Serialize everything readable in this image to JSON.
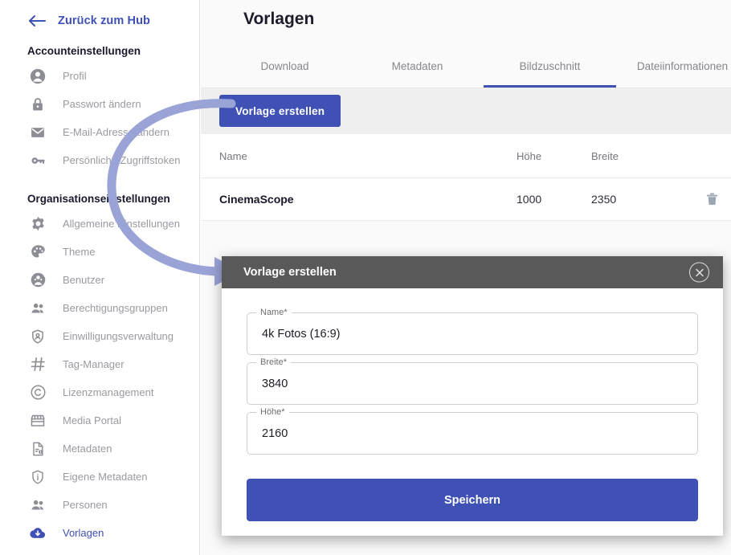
{
  "sidebar": {
    "back_link": {
      "label": "Zurück zum Hub",
      "icon": "arrow-left-icon"
    },
    "account_section": {
      "title": "Accounteinstellungen"
    },
    "account_items": [
      {
        "label": "Profil",
        "icon": "person-circle-icon"
      },
      {
        "label": "Passwort ändern",
        "icon": "lock-icon"
      },
      {
        "label": "E-Mail-Adresse ändern",
        "icon": "envelope-icon"
      },
      {
        "label": "Persönliche Zugriffstoken",
        "icon": "key-icon"
      }
    ],
    "org_section": {
      "title": "Organisationseinstellungen"
    },
    "org_items": [
      {
        "label": "Allgemeine Einstellungen",
        "icon": "gear-icon"
      },
      {
        "label": "Theme",
        "icon": "palette-icon"
      },
      {
        "label": "Benutzer",
        "icon": "user-circle-icon"
      },
      {
        "label": "Berechtigungsgruppen",
        "icon": "people-icon"
      },
      {
        "label": "Einwilligungsverwaltung",
        "icon": "shield-person-icon"
      },
      {
        "label": "Tag-Manager",
        "icon": "hash-icon"
      },
      {
        "label": "Lizenzmanagement",
        "icon": "copyright-icon"
      },
      {
        "label": "Media Portal",
        "icon": "storefront-icon"
      },
      {
        "label": "Metadaten",
        "icon": "document-info-icon"
      },
      {
        "label": "Eigene Metadaten",
        "icon": "shield-info-icon"
      },
      {
        "label": "Personen",
        "icon": "people-icon"
      },
      {
        "label": "Vorlagen",
        "icon": "cloud-download-icon",
        "active": true
      }
    ]
  },
  "main": {
    "page_title": "Vorlagen",
    "tabs": [
      {
        "label": "Download",
        "active": false
      },
      {
        "label": "Metadaten",
        "active": false
      },
      {
        "label": "Bildzuschnitt",
        "active": true
      },
      {
        "label": "Dateiinformationen",
        "active": false
      }
    ],
    "toolbar": {
      "create_label": "Vorlage erstellen"
    },
    "table": {
      "columns": [
        "Name",
        "Höhe",
        "Breite"
      ],
      "rows": [
        {
          "name": "CinemaScope",
          "hoehe": "1000",
          "breite": "2350",
          "delete_icon": "trash-icon"
        }
      ]
    }
  },
  "modal": {
    "title": "Vorlage erstellen",
    "close_icon": "close-circle-icon",
    "fields": [
      {
        "label": "Name",
        "required": "*",
        "value": "4k Fotos (16:9)"
      },
      {
        "label": "Breite",
        "required": "*",
        "value": "3840"
      },
      {
        "label": "Höhe",
        "required": "*",
        "value": "2160"
      }
    ],
    "save_label": "Speichern"
  },
  "annotation": {
    "arrow_icon": "curved-arrow-icon",
    "color": "#9aa3d6"
  },
  "colors": {
    "accent": "#3f51b5",
    "modal_header": "#595959",
    "toolbar_bg": "#efefef",
    "page_bg": "#fafafa",
    "muted_text": "#9a9aa2"
  }
}
